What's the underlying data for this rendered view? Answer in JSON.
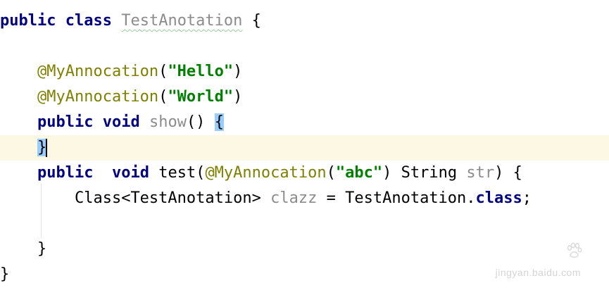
{
  "code": {
    "l1": {
      "kw1": "public",
      "kw2": "class",
      "name": "TestAnotation",
      "brace": "{"
    },
    "l3": {
      "ann": "@MyAnnocation",
      "open": "(",
      "str": "\"Hello\"",
      "close": ")"
    },
    "l4": {
      "ann": "@MyAnnocation",
      "open": "(",
      "str": "\"World\"",
      "close": ")"
    },
    "l5": {
      "kw1": "public",
      "kw2": "void",
      "name": "show",
      "parens": "()",
      "brace": "{"
    },
    "l6": {
      "brace": "}"
    },
    "l7": {
      "kw1": "public",
      "kw2": "void",
      "sig1": "test(",
      "ann": "@MyAnnocation",
      "open": "(",
      "str": "\"abc\"",
      "close": ")",
      "type": "String",
      "param": "str",
      "tail": ") {"
    },
    "l8": {
      "type": "Class<TestAnotation>",
      "var": "clazz",
      "eq": "=",
      "ref": "TestAnotation.",
      "kw": "class",
      "semi": ";"
    },
    "l10": {
      "brace": "}"
    },
    "l11": {
      "brace": "}"
    }
  },
  "watermark": {
    "logo": "Bai du 经验",
    "url": "jingyan.baidu.com"
  },
  "colors": {
    "keyword": "#000080",
    "annotation": "#808000",
    "string": "#008000",
    "unused": "#8c8c8c",
    "current_line": "#fdf8e3",
    "brace_match": "#99ccff"
  }
}
